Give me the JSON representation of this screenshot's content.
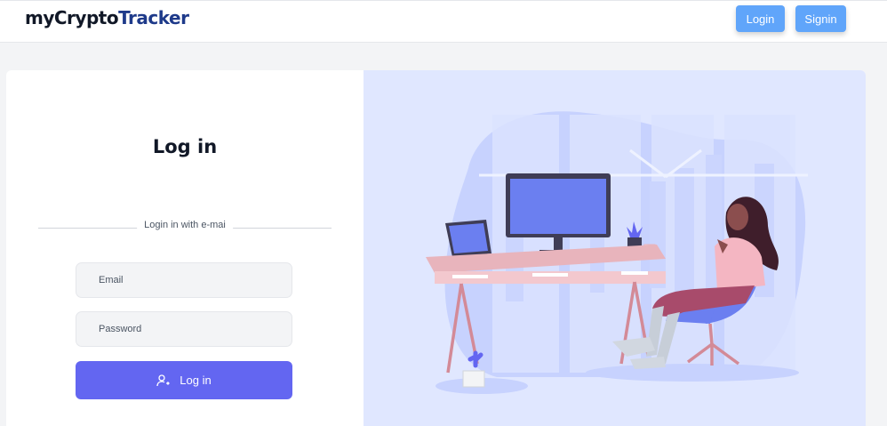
{
  "navbar": {
    "brand_prefix": "myCrypto",
    "brand_suffix": "Tracker",
    "login_label": "Login",
    "signin_label": "Signin"
  },
  "form": {
    "title": "Log in",
    "divider_text": "Login in with e-mai",
    "email_placeholder": "Email",
    "password_placeholder": "Password",
    "submit_label": "Log in"
  },
  "colors": {
    "accent": "#6366f1",
    "nav_button": "#60a5fa",
    "illustration_bg": "#e0e7ff"
  },
  "icons": {
    "submit": "user-login-icon"
  }
}
